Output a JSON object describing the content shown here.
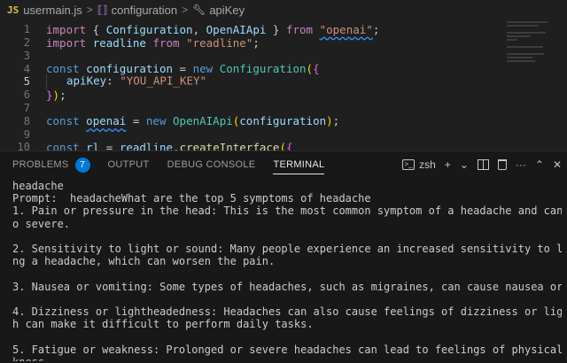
{
  "breadcrumb": {
    "file_badge": "JS",
    "file": "usermain.js",
    "sep": ">",
    "symbol1": "configuration",
    "symbol2": "apiKey"
  },
  "editor": {
    "lines": [
      {
        "num": "1",
        "tokens": [
          {
            "t": "import",
            "c": "kw"
          },
          {
            "t": " { ",
            "c": "punc"
          },
          {
            "t": "Configuration",
            "c": "id"
          },
          {
            "t": ", ",
            "c": "punc"
          },
          {
            "t": "OpenAIApi",
            "c": "id"
          },
          {
            "t": " } ",
            "c": "punc"
          },
          {
            "t": "from",
            "c": "kw"
          },
          {
            "t": " ",
            "c": "punc"
          },
          {
            "t": "\"openai\"",
            "c": "str squig"
          },
          {
            "t": ";",
            "c": "punc"
          }
        ]
      },
      {
        "num": "2",
        "tokens": [
          {
            "t": "import",
            "c": "kw"
          },
          {
            "t": " ",
            "c": "punc"
          },
          {
            "t": "readline",
            "c": "id"
          },
          {
            "t": " ",
            "c": "punc"
          },
          {
            "t": "from",
            "c": "kw"
          },
          {
            "t": " ",
            "c": "punc"
          },
          {
            "t": "\"readline\"",
            "c": "str"
          },
          {
            "t": ";",
            "c": "punc"
          }
        ]
      },
      {
        "num": "3",
        "tokens": []
      },
      {
        "num": "4",
        "tokens": [
          {
            "t": "const",
            "c": "kw2"
          },
          {
            "t": " ",
            "c": "punc"
          },
          {
            "t": "configuration",
            "c": "id"
          },
          {
            "t": " = ",
            "c": "punc"
          },
          {
            "t": "new",
            "c": "kw2"
          },
          {
            "t": " ",
            "c": "punc"
          },
          {
            "t": "Configuration",
            "c": "cls"
          },
          {
            "t": "(",
            "c": "brace1"
          },
          {
            "t": "{",
            "c": "brace2"
          }
        ]
      },
      {
        "num": "5",
        "active": true,
        "indent": true,
        "tokens": [
          {
            "t": "apiKey",
            "c": "id"
          },
          {
            "t": ": ",
            "c": "punc"
          },
          {
            "t": "\"YOU_API_KEY\"",
            "c": "str"
          }
        ]
      },
      {
        "num": "6",
        "tokens": [
          {
            "t": "}",
            "c": "brace2"
          },
          {
            "t": ")",
            "c": "brace1"
          },
          {
            "t": ";",
            "c": "punc"
          }
        ]
      },
      {
        "num": "7",
        "tokens": []
      },
      {
        "num": "8",
        "tokens": [
          {
            "t": "const",
            "c": "kw2"
          },
          {
            "t": " ",
            "c": "punc"
          },
          {
            "t": "openai",
            "c": "id squig"
          },
          {
            "t": " = ",
            "c": "punc"
          },
          {
            "t": "new",
            "c": "kw2"
          },
          {
            "t": " ",
            "c": "punc"
          },
          {
            "t": "OpenAIApi",
            "c": "cls"
          },
          {
            "t": "(",
            "c": "brace1"
          },
          {
            "t": "configuration",
            "c": "id"
          },
          {
            "t": ")",
            "c": "brace1"
          },
          {
            "t": ";",
            "c": "punc"
          }
        ]
      },
      {
        "num": "9",
        "tokens": []
      },
      {
        "num": "10",
        "tokens": [
          {
            "t": "const",
            "c": "kw2"
          },
          {
            "t": " ",
            "c": "punc"
          },
          {
            "t": "rl",
            "c": "id"
          },
          {
            "t": " = ",
            "c": "punc"
          },
          {
            "t": "readline",
            "c": "id"
          },
          {
            "t": ".",
            "c": "punc"
          },
          {
            "t": "createInterface",
            "c": "fn"
          },
          {
            "t": "(",
            "c": "brace1"
          },
          {
            "t": "{",
            "c": "brace2"
          }
        ]
      }
    ]
  },
  "panel": {
    "tabs": [
      {
        "label": "PROBLEMS",
        "badge": "7",
        "name": "tab-problems"
      },
      {
        "label": "OUTPUT",
        "name": "tab-output"
      },
      {
        "label": "DEBUG CONSOLE",
        "name": "tab-debug-console"
      },
      {
        "label": "TERMINAL",
        "name": "tab-terminal",
        "active": true
      }
    ],
    "shell_name": "zsh",
    "icons": {
      "terminal": "terminal-icon",
      "add": "plus-icon",
      "dropdown": "chevron-down-icon",
      "split": "split-terminal-icon",
      "trash": "trash-icon",
      "more": "ellipsis-icon",
      "maximize": "chevron-up-icon",
      "close": "close-icon"
    }
  },
  "terminal": {
    "lines": [
      "headache",
      "Prompt:  headacheWhat are the top 5 symptoms of headache",
      "1. Pain or pressure in the head: This is the most common symptom of a headache and can range from mild t",
      "o severe.",
      "",
      "2. Sensitivity to light or sound: Many people experience an increased sensitivity to light or sound duri",
      "ng a headache, which can worsen the pain.",
      "",
      "3. Nausea or vomiting: Some types of headaches, such as migraines, can cause nausea or vomiting.",
      "",
      "4. Dizziness or lightheadedness: Headaches can also cause feelings of dizziness or lightheadedness, whic",
      "h can make it difficult to perform daily tasks.",
      "",
      "5. Fatigue or weakness: Prolonged or severe headaches can lead to feelings of physical exhaustion or wea",
      "kness."
    ]
  }
}
